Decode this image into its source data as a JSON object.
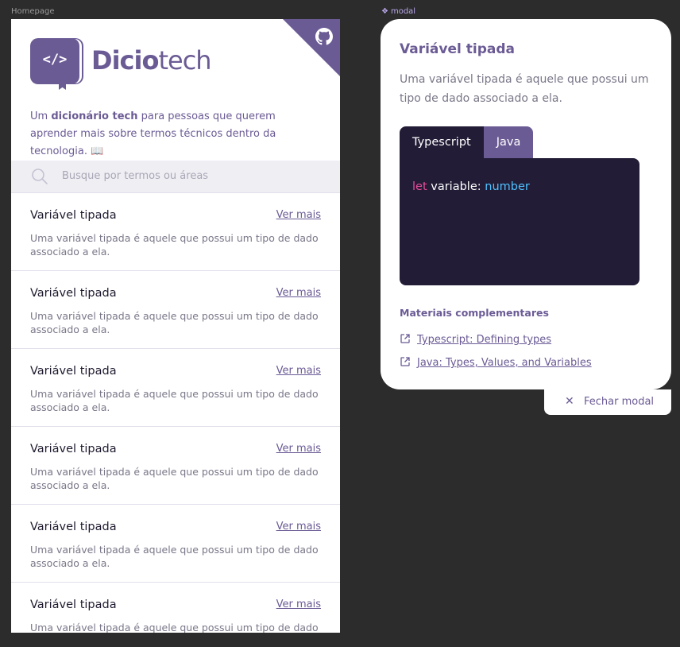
{
  "frames": {
    "homepage_label": "Homepage",
    "modal_label": "modal"
  },
  "home": {
    "brand_bold": "Dicio",
    "brand_light": "tech",
    "logo_code": "</>",
    "intro_prefix": "Um ",
    "intro_bold": "dicionário tech",
    "intro_suffix": " para pessoas que querem aprender mais sobre termos técnicos dentro da tecnologia. 📖",
    "search_placeholder": "Busque por termos ou áreas",
    "cards": [
      {
        "title": "Variável tipada",
        "more": "Ver mais",
        "desc": "Uma variável tipada é aquele que possui um tipo de dado associado a ela."
      },
      {
        "title": "Variável tipada",
        "more": "Ver mais",
        "desc": "Uma variável tipada é aquele que possui um tipo de dado associado a ela."
      },
      {
        "title": "Variável tipada",
        "more": "Ver mais",
        "desc": "Uma variável tipada é aquele que possui um tipo de dado associado a ela."
      },
      {
        "title": "Variável tipada",
        "more": "Ver mais",
        "desc": "Uma variável tipada é aquele que possui um tipo de dado associado a ela."
      },
      {
        "title": "Variável tipada",
        "more": "Ver mais",
        "desc": "Uma variável tipada é aquele que possui um tipo de dado associado a ela."
      },
      {
        "title": "Variável tipada",
        "more": "Ver mais",
        "desc": "Uma variável tipada é aquele que possui um tipo de dado associado a ela."
      }
    ]
  },
  "modal": {
    "title": "Variável tipada",
    "description": "Uma variável tipada é aquele que possui um tipo de dado associado a ela.",
    "tabs": [
      {
        "label": "Typescript",
        "active": true
      },
      {
        "label": "Java",
        "active": false
      }
    ],
    "code": {
      "keyword": "let",
      "ident": " variable: ",
      "type": "number"
    },
    "materials_title": "Materiais complementares",
    "links": [
      {
        "label": "Typescript: Defining types"
      },
      {
        "label": "Java: Types, Values, and Variables"
      }
    ],
    "close_label": "Fechar modal"
  },
  "colors": {
    "brand": "#6b5b95",
    "code_bg": "#221c36",
    "keyword": "#e84c9b",
    "type": "#4fc1ff"
  },
  "icons": [
    "github-icon",
    "search-icon",
    "external-link-icon",
    "close-icon",
    "book-icon"
  ]
}
